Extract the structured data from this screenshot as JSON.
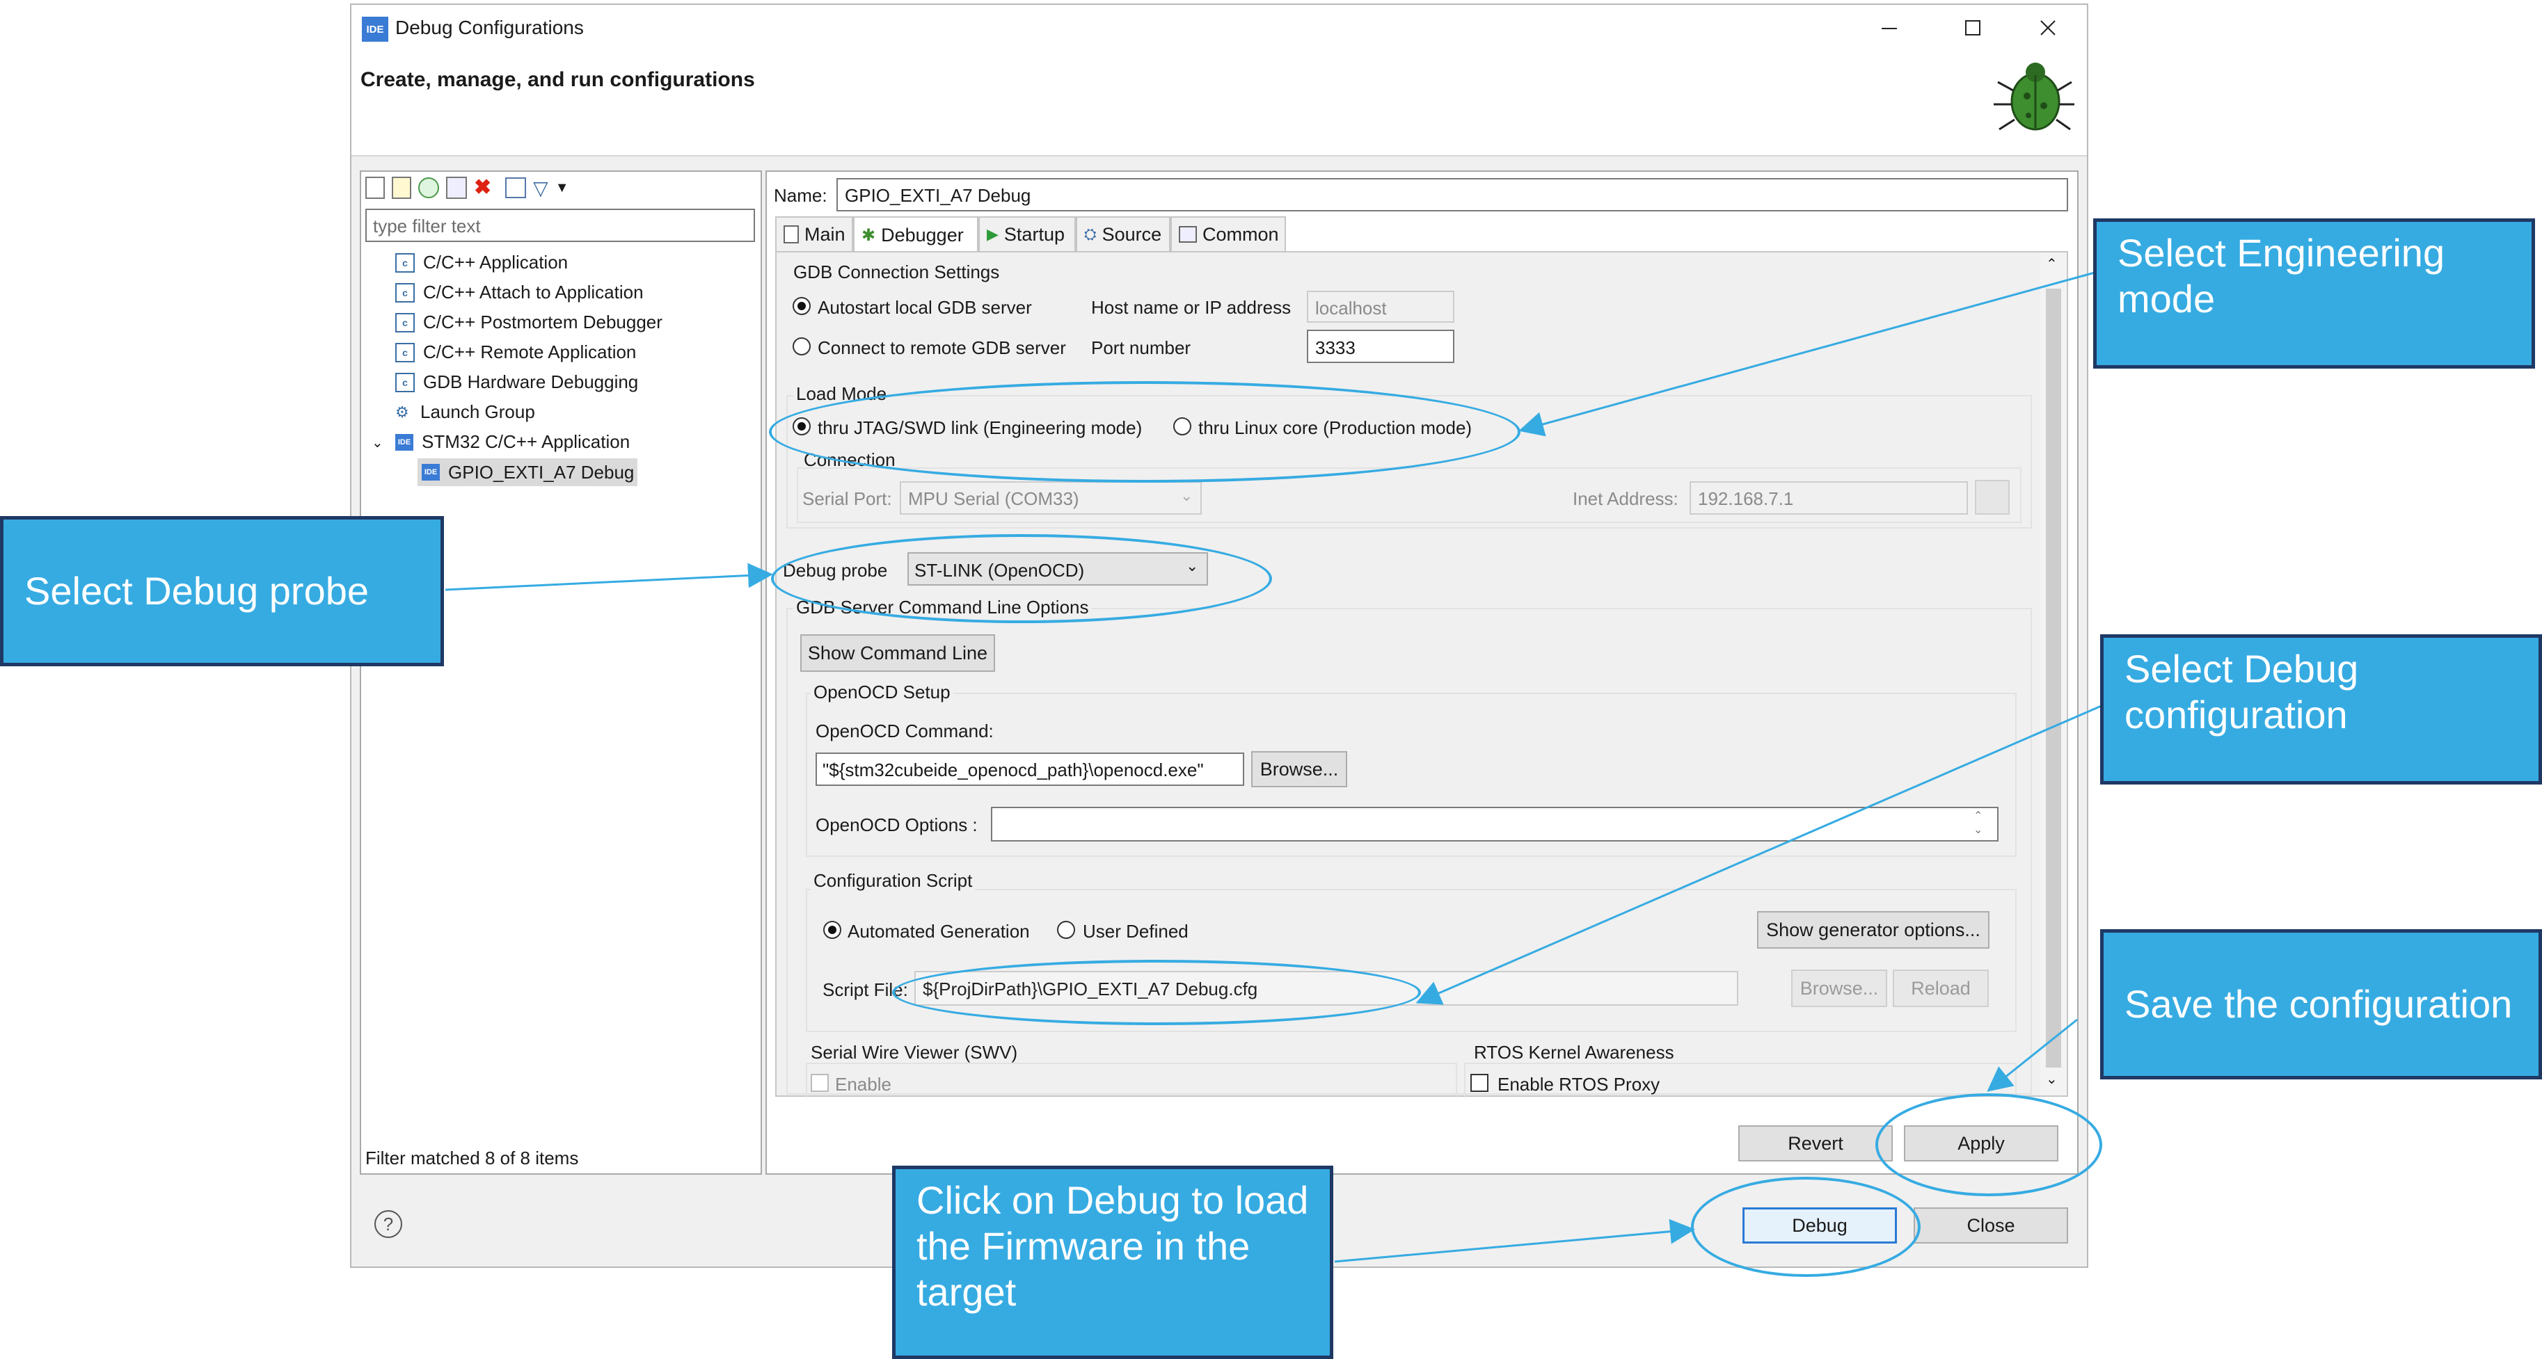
{
  "window": {
    "title": "Debug Configurations",
    "heading": "Create, manage, and run configurations",
    "logo_text": "IDE"
  },
  "left": {
    "filter_placeholder": "type filter text",
    "tree": [
      "C/C++ Application",
      "C/C++ Attach to Application",
      "C/C++ Postmortem Debugger",
      "C/C++ Remote Application",
      "GDB Hardware Debugging",
      "Launch Group",
      "STM32 C/C++ Application",
      "GPIO_EXTI_A7 Debug"
    ],
    "status": "Filter matched 8 of 8 items"
  },
  "config": {
    "name_label": "Name:",
    "name_value": "GPIO_EXTI_A7 Debug",
    "tabs": [
      "Main",
      "Debugger",
      "Startup",
      "Source",
      "Common"
    ],
    "gdb_section": "GDB Connection Settings",
    "autostart": "Autostart local GDB server",
    "host_label": "Host name or IP address",
    "host_value": "localhost",
    "connect_remote": "Connect to remote GDB server",
    "port_label": "Port number",
    "port_value": "3333",
    "load_mode": "Load Mode",
    "engineering": "thru JTAG/SWD link (Engineering mode)",
    "production": "thru Linux core (Production mode)",
    "connection": "Connection",
    "serial_port_label": "Serial Port:",
    "serial_port_value": "MPU Serial (COM33)",
    "inet_label": "Inet Address:",
    "inet_value": "192.168.7.1",
    "probe_label": "Debug probe",
    "probe_value": "ST-LINK (OpenOCD)",
    "cmdline_section": "GDB Server Command Line Options",
    "show_cmd": "Show Command Line",
    "openocd_setup": "OpenOCD Setup",
    "openocd_cmd_label": "OpenOCD Command:",
    "openocd_cmd_value": "\"${stm32cubeide_openocd_path}\\openocd.exe\"",
    "browse": "Browse...",
    "openocd_options_label": "OpenOCD Options :",
    "config_script": "Configuration Script",
    "automated": "Automated Generation",
    "user_defined": "User Defined",
    "show_generator": "Show generator options...",
    "script_label": "Script File:",
    "script_value": "${ProjDirPath}\\GPIO_EXTI_A7 Debug.cfg",
    "browse_dis": "Browse...",
    "reload": "Reload",
    "swv": "Serial Wire Viewer (SWV)",
    "enable": "Enable",
    "rtos": "RTOS Kernel Awareness",
    "rtos_proxy": "Enable RTOS Proxy"
  },
  "buttons": {
    "revert": "Revert",
    "apply": "Apply",
    "debug": "Debug",
    "close": "Close",
    "help": "?"
  },
  "callouts": {
    "engineering": "Select Engineering mode",
    "probe": "Select Debug probe",
    "config": "Select Debug configuration",
    "save": "Save the configuration",
    "debug": "Click on Debug to load the Firmware in the target"
  }
}
